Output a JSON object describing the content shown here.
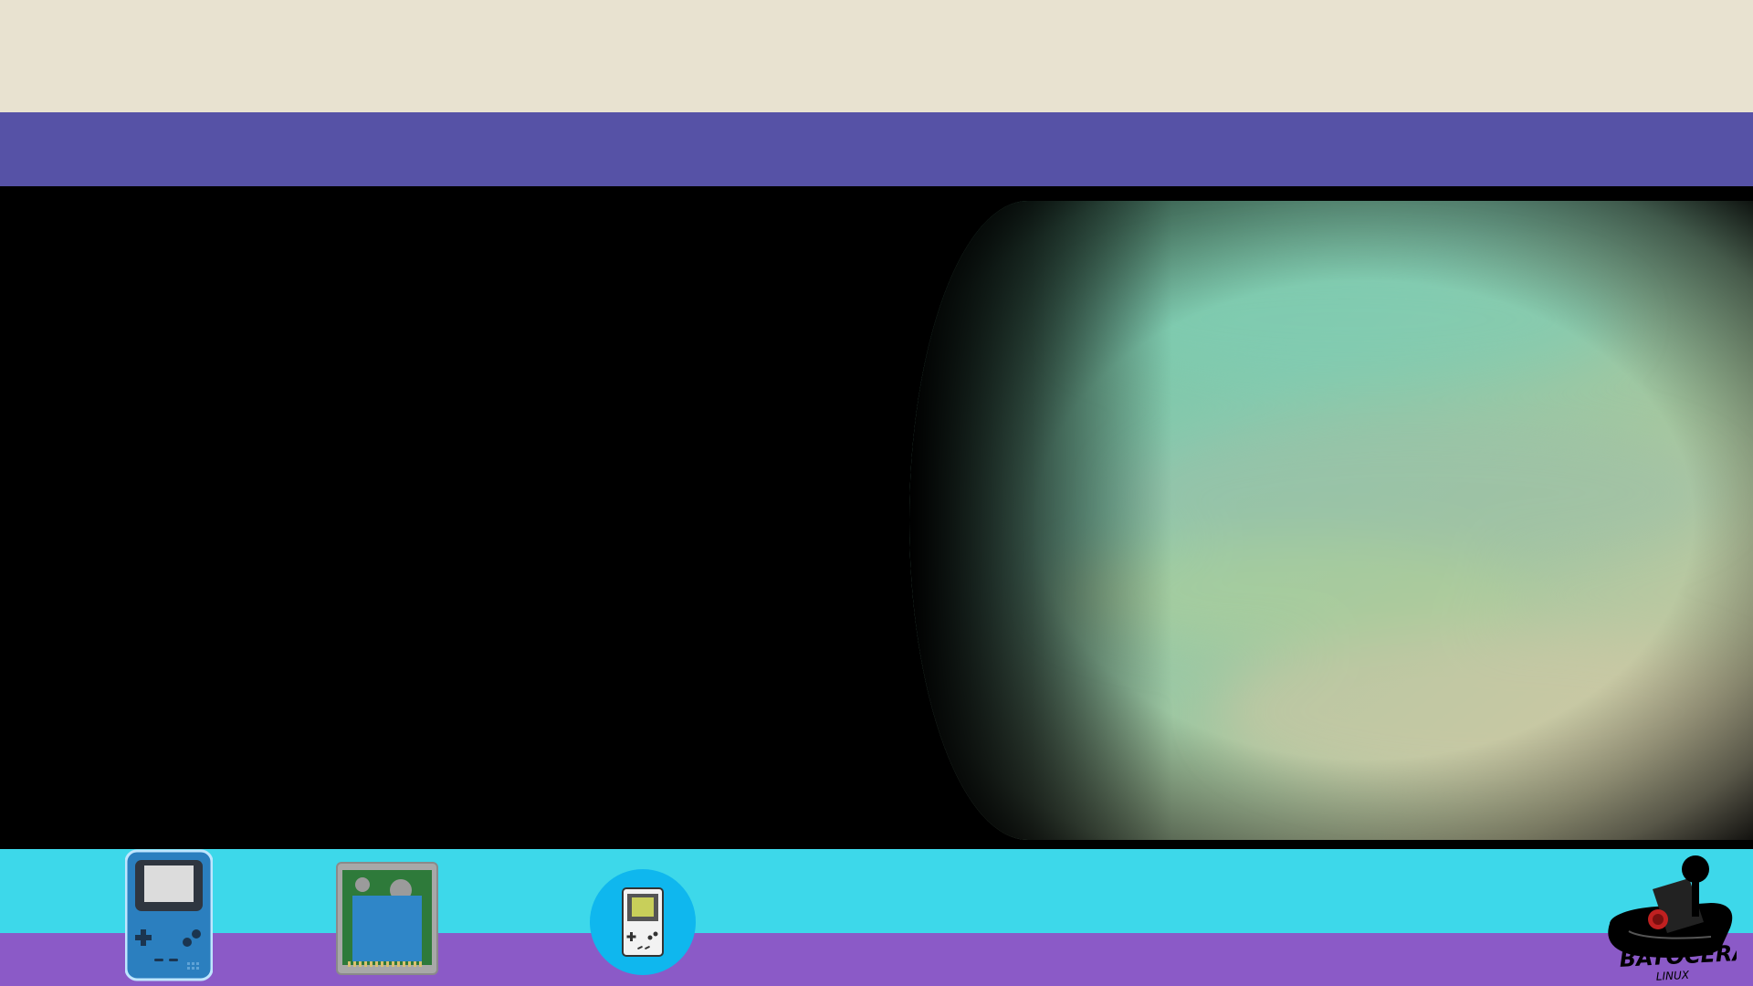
{
  "colors": {
    "top_band": "#E8E2D0",
    "header_bar": "#5652A6",
    "main_bg": "#000000",
    "bottom_cyan": "#3DD8EA",
    "bottom_purple": "#8B5AC7",
    "gb_circle": "#0FB7EE"
  },
  "icons": {
    "gbc": "gameboy-color-icon",
    "cart": "game-cartridge-icon",
    "gb": "gameboy-icon"
  },
  "logo": {
    "main": "BATOCERA",
    "sub": "LINUX"
  }
}
